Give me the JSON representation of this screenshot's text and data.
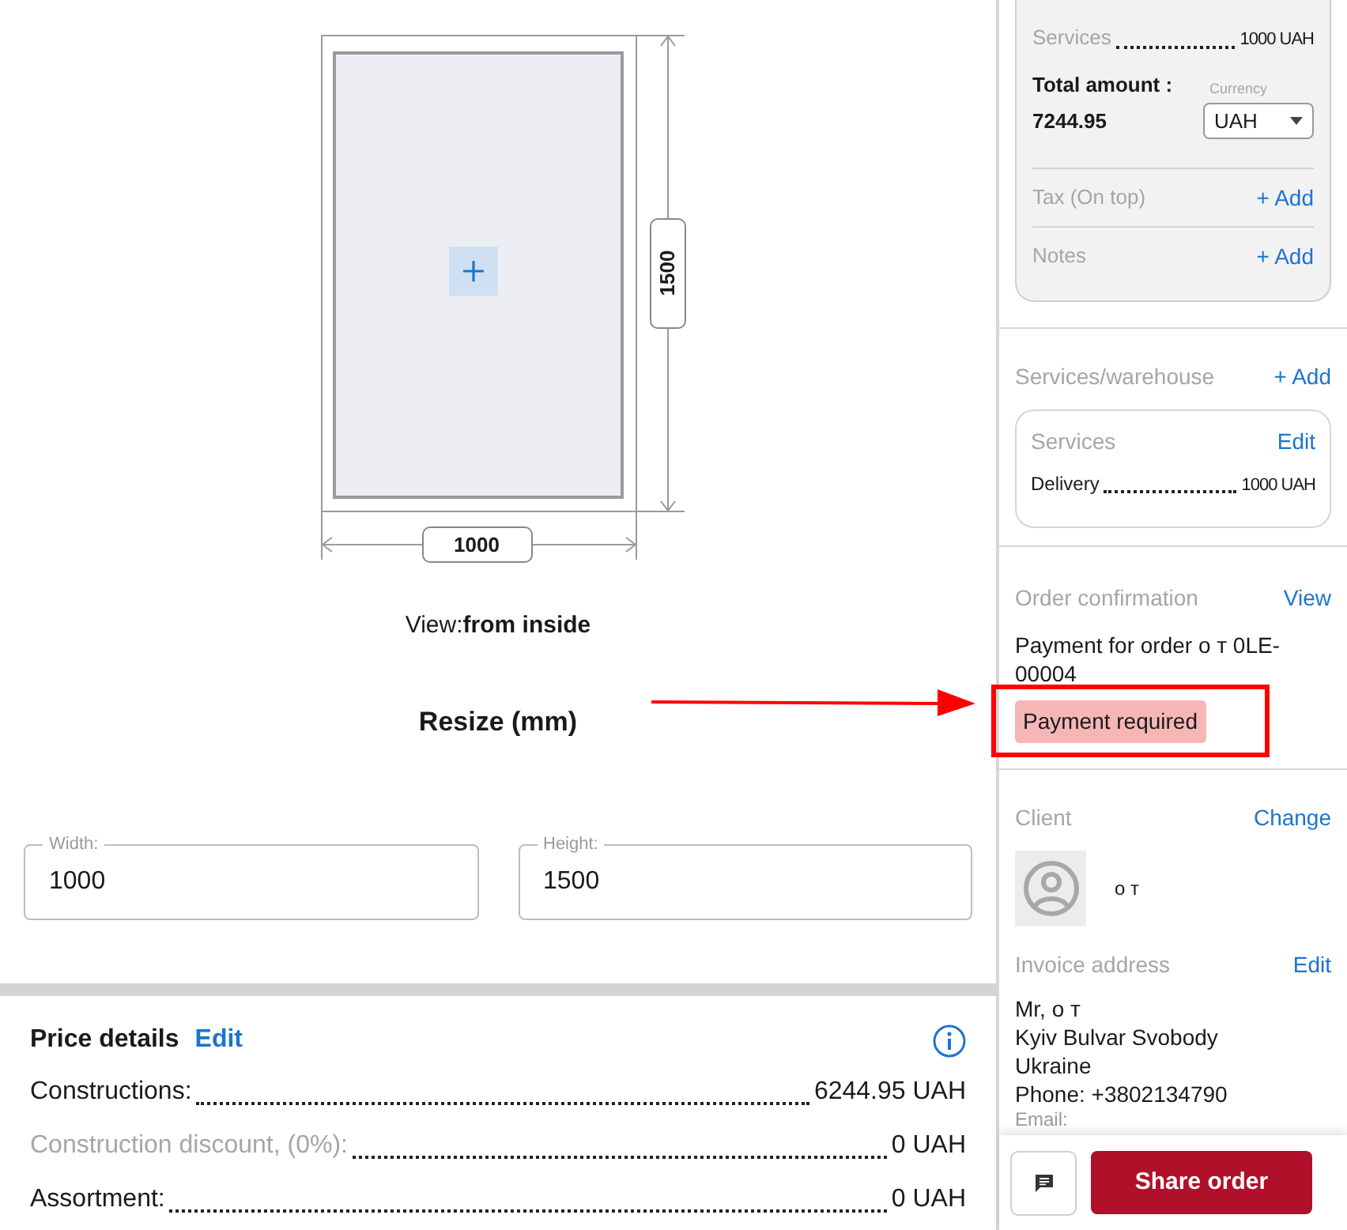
{
  "window_drawing": {
    "width_label": "1000",
    "height_label": "1500"
  },
  "view": {
    "label": "View:",
    "value": "from inside"
  },
  "resize_title": "Resize (mm)",
  "fields": [
    {
      "label": "Width:",
      "value": "1000"
    },
    {
      "label": "Height:",
      "value": "1500"
    }
  ],
  "price_details": {
    "title": "Price details",
    "action": "Edit",
    "rows": [
      {
        "label": "Constructions:",
        "value": "6244.95 UAH",
        "muted": false
      },
      {
        "label": "Construction discount, (0%):",
        "value": "0 UAH",
        "muted": true
      },
      {
        "label": "Assortment:",
        "value": "0 UAH",
        "muted": false
      }
    ]
  },
  "summary": {
    "rows": [
      {
        "label": "Services",
        "value": "1000 UAH"
      }
    ],
    "total_label": "Total amount :",
    "total": "7244.95",
    "currency_label": "Currency",
    "currency": "UAH",
    "extras": [
      {
        "label": "Tax (On top)",
        "action": "+ Add"
      },
      {
        "label": "Notes",
        "action": "+ Add"
      }
    ]
  },
  "services_warehouse": {
    "title": "Services/warehouse",
    "action": "+ Add",
    "card_title": "Services",
    "card_action": "Edit",
    "rows": [
      {
        "label": "Delivery",
        "value": "1000 UAH"
      }
    ]
  },
  "order_confirmation": {
    "title": "Order confirmation",
    "action": "View",
    "text": "Payment for order о т 0LE-00004",
    "status": "Payment required"
  },
  "client": {
    "title": "Client",
    "action": "Change",
    "name": "о т"
  },
  "invoice_address": {
    "title": "Invoice address",
    "action": "Edit",
    "lines": [
      "Mr, о т",
      "Kyiv Bulvar Svobody",
      "Ukraine",
      "Phone: +3802134790",
      "Email:"
    ]
  },
  "footer": {
    "share": "Share order"
  }
}
